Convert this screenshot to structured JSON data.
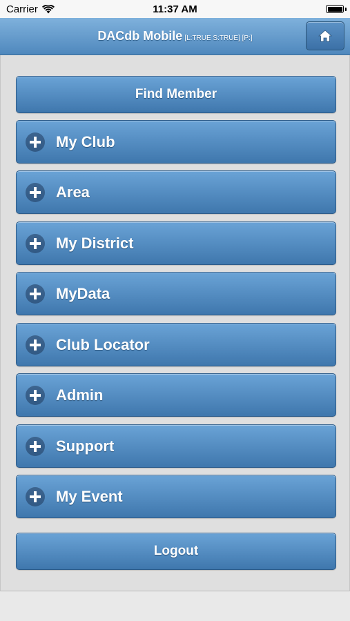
{
  "status_bar": {
    "carrier": "Carrier",
    "time": "11:37 AM"
  },
  "header": {
    "title": "DACdb Mobile",
    "subtitle": "[L:TRUE S:TRUE] [P:]",
    "home_icon": "home-icon"
  },
  "find_member_label": "Find Member",
  "menu_items": [
    {
      "label": "My Club",
      "icon": "plus-circle-icon"
    },
    {
      "label": "Area",
      "icon": "plus-circle-icon"
    },
    {
      "label": "My District",
      "icon": "plus-circle-icon"
    },
    {
      "label": "MyData",
      "icon": "plus-circle-icon"
    },
    {
      "label": "Club Locator",
      "icon": "plus-circle-icon"
    },
    {
      "label": "Admin",
      "icon": "plus-circle-icon"
    },
    {
      "label": "Support",
      "icon": "plus-circle-icon"
    },
    {
      "label": "My Event",
      "icon": "plus-circle-icon"
    }
  ],
  "logout_label": "Logout",
  "colors": {
    "header_top": "#7fb1dc",
    "header_bottom": "#4f88bd",
    "button_top": "#6aa3d6",
    "button_bottom": "#3f77ad",
    "background": "#dfdfdf"
  }
}
